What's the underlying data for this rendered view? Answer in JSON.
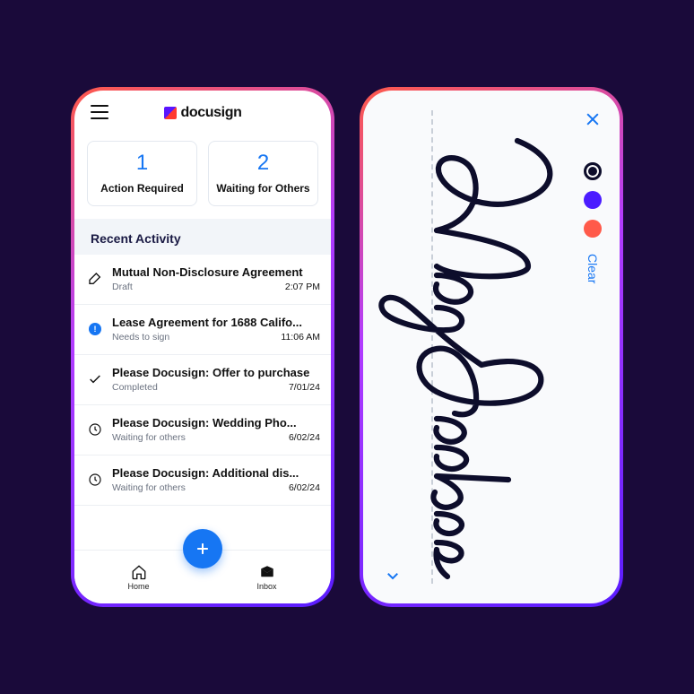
{
  "brand": {
    "name": "docusign"
  },
  "summary": [
    {
      "count": "1",
      "label": "Action Required"
    },
    {
      "count": "2",
      "label": "Waiting for Others"
    }
  ],
  "sectionTitle": "Recent Activity",
  "activity": [
    {
      "icon": "pen",
      "title": "Mutual Non-Disclosure Agreement",
      "status": "Draft",
      "time": "2:07 PM"
    },
    {
      "icon": "alert",
      "title": "Lease Agreement for 1688 Califo...",
      "status": "Needs to sign",
      "time": "11:06 AM"
    },
    {
      "icon": "check",
      "title": "Please Docusign: Offer to purchase",
      "status": "Completed",
      "time": "7/01/24"
    },
    {
      "icon": "clock",
      "title": "Please Docusign: Wedding Pho...",
      "status": "Waiting for others",
      "time": "6/02/24"
    },
    {
      "icon": "clock",
      "title": "Please Docusign: Additional dis...",
      "status": "Waiting for others",
      "time": "6/02/24"
    }
  ],
  "nav": {
    "home": "Home",
    "inbox": "Inbox"
  },
  "signature": {
    "clear": "Clear",
    "colors": {
      "black": "#0d0d2b",
      "blue": "#4b1cff",
      "red": "#ff5a4a"
    }
  }
}
